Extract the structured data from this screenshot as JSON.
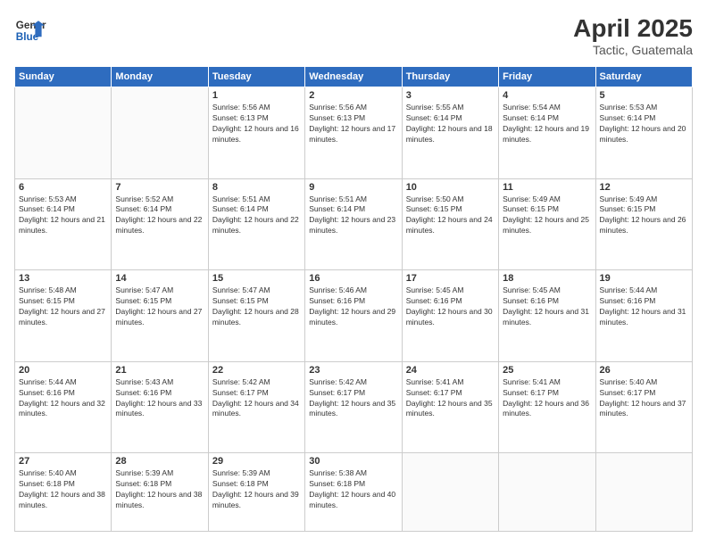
{
  "header": {
    "logo_line1": "General",
    "logo_line2": "Blue",
    "month": "April 2025",
    "location": "Tactic, Guatemala"
  },
  "weekdays": [
    "Sunday",
    "Monday",
    "Tuesday",
    "Wednesday",
    "Thursday",
    "Friday",
    "Saturday"
  ],
  "weeks": [
    [
      {
        "day": "",
        "info": ""
      },
      {
        "day": "",
        "info": ""
      },
      {
        "day": "1",
        "info": "Sunrise: 5:56 AM\nSunset: 6:13 PM\nDaylight: 12 hours and 16 minutes."
      },
      {
        "day": "2",
        "info": "Sunrise: 5:56 AM\nSunset: 6:13 PM\nDaylight: 12 hours and 17 minutes."
      },
      {
        "day": "3",
        "info": "Sunrise: 5:55 AM\nSunset: 6:14 PM\nDaylight: 12 hours and 18 minutes."
      },
      {
        "day": "4",
        "info": "Sunrise: 5:54 AM\nSunset: 6:14 PM\nDaylight: 12 hours and 19 minutes."
      },
      {
        "day": "5",
        "info": "Sunrise: 5:53 AM\nSunset: 6:14 PM\nDaylight: 12 hours and 20 minutes."
      }
    ],
    [
      {
        "day": "6",
        "info": "Sunrise: 5:53 AM\nSunset: 6:14 PM\nDaylight: 12 hours and 21 minutes."
      },
      {
        "day": "7",
        "info": "Sunrise: 5:52 AM\nSunset: 6:14 PM\nDaylight: 12 hours and 22 minutes."
      },
      {
        "day": "8",
        "info": "Sunrise: 5:51 AM\nSunset: 6:14 PM\nDaylight: 12 hours and 22 minutes."
      },
      {
        "day": "9",
        "info": "Sunrise: 5:51 AM\nSunset: 6:14 PM\nDaylight: 12 hours and 23 minutes."
      },
      {
        "day": "10",
        "info": "Sunrise: 5:50 AM\nSunset: 6:15 PM\nDaylight: 12 hours and 24 minutes."
      },
      {
        "day": "11",
        "info": "Sunrise: 5:49 AM\nSunset: 6:15 PM\nDaylight: 12 hours and 25 minutes."
      },
      {
        "day": "12",
        "info": "Sunrise: 5:49 AM\nSunset: 6:15 PM\nDaylight: 12 hours and 26 minutes."
      }
    ],
    [
      {
        "day": "13",
        "info": "Sunrise: 5:48 AM\nSunset: 6:15 PM\nDaylight: 12 hours and 27 minutes."
      },
      {
        "day": "14",
        "info": "Sunrise: 5:47 AM\nSunset: 6:15 PM\nDaylight: 12 hours and 27 minutes."
      },
      {
        "day": "15",
        "info": "Sunrise: 5:47 AM\nSunset: 6:15 PM\nDaylight: 12 hours and 28 minutes."
      },
      {
        "day": "16",
        "info": "Sunrise: 5:46 AM\nSunset: 6:16 PM\nDaylight: 12 hours and 29 minutes."
      },
      {
        "day": "17",
        "info": "Sunrise: 5:45 AM\nSunset: 6:16 PM\nDaylight: 12 hours and 30 minutes."
      },
      {
        "day": "18",
        "info": "Sunrise: 5:45 AM\nSunset: 6:16 PM\nDaylight: 12 hours and 31 minutes."
      },
      {
        "day": "19",
        "info": "Sunrise: 5:44 AM\nSunset: 6:16 PM\nDaylight: 12 hours and 31 minutes."
      }
    ],
    [
      {
        "day": "20",
        "info": "Sunrise: 5:44 AM\nSunset: 6:16 PM\nDaylight: 12 hours and 32 minutes."
      },
      {
        "day": "21",
        "info": "Sunrise: 5:43 AM\nSunset: 6:16 PM\nDaylight: 12 hours and 33 minutes."
      },
      {
        "day": "22",
        "info": "Sunrise: 5:42 AM\nSunset: 6:17 PM\nDaylight: 12 hours and 34 minutes."
      },
      {
        "day": "23",
        "info": "Sunrise: 5:42 AM\nSunset: 6:17 PM\nDaylight: 12 hours and 35 minutes."
      },
      {
        "day": "24",
        "info": "Sunrise: 5:41 AM\nSunset: 6:17 PM\nDaylight: 12 hours and 35 minutes."
      },
      {
        "day": "25",
        "info": "Sunrise: 5:41 AM\nSunset: 6:17 PM\nDaylight: 12 hours and 36 minutes."
      },
      {
        "day": "26",
        "info": "Sunrise: 5:40 AM\nSunset: 6:17 PM\nDaylight: 12 hours and 37 minutes."
      }
    ],
    [
      {
        "day": "27",
        "info": "Sunrise: 5:40 AM\nSunset: 6:18 PM\nDaylight: 12 hours and 38 minutes."
      },
      {
        "day": "28",
        "info": "Sunrise: 5:39 AM\nSunset: 6:18 PM\nDaylight: 12 hours and 38 minutes."
      },
      {
        "day": "29",
        "info": "Sunrise: 5:39 AM\nSunset: 6:18 PM\nDaylight: 12 hours and 39 minutes."
      },
      {
        "day": "30",
        "info": "Sunrise: 5:38 AM\nSunset: 6:18 PM\nDaylight: 12 hours and 40 minutes."
      },
      {
        "day": "",
        "info": ""
      },
      {
        "day": "",
        "info": ""
      },
      {
        "day": "",
        "info": ""
      }
    ]
  ]
}
